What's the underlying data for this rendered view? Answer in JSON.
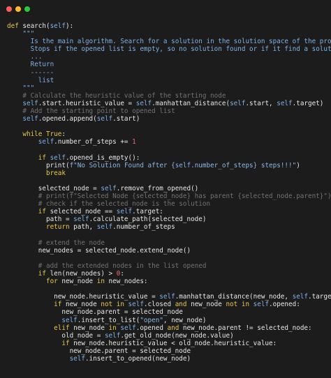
{
  "window": {
    "buttons": [
      "close",
      "minimize",
      "maximize"
    ]
  },
  "code": {
    "language": "python",
    "lines": [
      {
        "indent": 0,
        "tokens": [
          [
            "kw",
            "def "
          ],
          [
            "fn",
            "search("
          ],
          [
            "self",
            "self"
          ],
          [
            "fn",
            "):"
          ]
        ]
      },
      {
        "indent": 4,
        "tokens": [
          [
            "doc",
            "\"\"\""
          ]
        ]
      },
      {
        "indent": 6,
        "tokens": [
          [
            "doc",
            "Is the main algorithm. Search for a solution in the solution space of the problem"
          ]
        ]
      },
      {
        "indent": 6,
        "tokens": [
          [
            "doc",
            "Stops if the opened list is empty, so no solution found or if it find a solution."
          ]
        ]
      },
      {
        "indent": 6,
        "tokens": [
          [
            "doc",
            "..."
          ]
        ]
      },
      {
        "indent": 6,
        "tokens": [
          [
            "doc",
            "Return"
          ]
        ]
      },
      {
        "indent": 6,
        "tokens": [
          [
            "doc",
            "------"
          ]
        ]
      },
      {
        "indent": 8,
        "tokens": [
          [
            "doc",
            "list"
          ]
        ]
      },
      {
        "indent": 4,
        "tokens": [
          [
            "doc",
            "\"\"\""
          ]
        ]
      },
      {
        "indent": 4,
        "tokens": [
          [
            "cmt",
            "# Calculate the heuristic value of the starting node"
          ]
        ]
      },
      {
        "indent": 4,
        "tokens": [
          [
            "self",
            "self"
          ],
          [
            "fn",
            ".start.heuristic_value = "
          ],
          [
            "self",
            "self"
          ],
          [
            "fn",
            ".manhattan_distance("
          ],
          [
            "self",
            "self"
          ],
          [
            "fn",
            ".start, "
          ],
          [
            "self",
            "self"
          ],
          [
            "fn",
            ".target)"
          ]
        ]
      },
      {
        "indent": 4,
        "tokens": [
          [
            "cmt",
            "# Add the starting point to opened list"
          ]
        ]
      },
      {
        "indent": 4,
        "tokens": [
          [
            "self",
            "self"
          ],
          [
            "fn",
            ".opened.append("
          ],
          [
            "self",
            "self"
          ],
          [
            "fn",
            ".start)"
          ]
        ]
      },
      {
        "indent": 0,
        "tokens": []
      },
      {
        "indent": 4,
        "tokens": [
          [
            "kw",
            "while "
          ],
          [
            "kw",
            "True"
          ],
          [
            "fn",
            ":"
          ]
        ]
      },
      {
        "indent": 8,
        "tokens": [
          [
            "self",
            "self"
          ],
          [
            "fn",
            ".number_of_steps += "
          ],
          [
            "num",
            "1"
          ]
        ]
      },
      {
        "indent": 0,
        "tokens": []
      },
      {
        "indent": 8,
        "tokens": [
          [
            "kw",
            "if "
          ],
          [
            "self",
            "self"
          ],
          [
            "fn",
            ".opened_is_empty():"
          ]
        ]
      },
      {
        "indent": 10,
        "tokens": [
          [
            "fn",
            "print("
          ],
          [
            "str",
            "f\"No Solution Found after {"
          ],
          [
            "self",
            "self"
          ],
          [
            "str",
            ".number_of_steps} steps!!!\""
          ],
          [
            "fn",
            ")"
          ]
        ]
      },
      {
        "indent": 10,
        "tokens": [
          [
            "kw",
            "break"
          ]
        ]
      },
      {
        "indent": 0,
        "tokens": []
      },
      {
        "indent": 8,
        "tokens": [
          [
            "fn",
            "selected_node = "
          ],
          [
            "self",
            "self"
          ],
          [
            "fn",
            ".remove_from_opened()"
          ]
        ]
      },
      {
        "indent": 8,
        "tokens": [
          [
            "cmt",
            "# print(f\"Selected Node {selected_node} has parent {selected_node.parent}\")"
          ]
        ]
      },
      {
        "indent": 8,
        "tokens": [
          [
            "cmt",
            "# check if the selected_node is the solution"
          ]
        ]
      },
      {
        "indent": 8,
        "tokens": [
          [
            "kw",
            "if "
          ],
          [
            "fn",
            "selected_node == "
          ],
          [
            "self",
            "self"
          ],
          [
            "fn",
            ".target:"
          ]
        ]
      },
      {
        "indent": 10,
        "tokens": [
          [
            "fn",
            "path = "
          ],
          [
            "self",
            "self"
          ],
          [
            "fn",
            ".calculate_path(selected_node)"
          ]
        ]
      },
      {
        "indent": 10,
        "tokens": [
          [
            "kw",
            "return "
          ],
          [
            "fn",
            "path, "
          ],
          [
            "self",
            "self"
          ],
          [
            "fn",
            ".number_of_steps"
          ]
        ]
      },
      {
        "indent": 0,
        "tokens": []
      },
      {
        "indent": 8,
        "tokens": [
          [
            "cmt",
            "# extend the node"
          ]
        ]
      },
      {
        "indent": 8,
        "tokens": [
          [
            "fn",
            "new_nodes = selected_node.extend_node()"
          ]
        ]
      },
      {
        "indent": 0,
        "tokens": []
      },
      {
        "indent": 8,
        "tokens": [
          [
            "cmt",
            "# add the extended nodes in the list opened"
          ]
        ]
      },
      {
        "indent": 8,
        "tokens": [
          [
            "kw",
            "if "
          ],
          [
            "fn",
            "len(new_nodes) > "
          ],
          [
            "num",
            "0"
          ],
          [
            "fn",
            ":"
          ]
        ]
      },
      {
        "indent": 10,
        "tokens": [
          [
            "kw",
            "for "
          ],
          [
            "fn",
            "new_node "
          ],
          [
            "kw",
            "in "
          ],
          [
            "fn",
            "new_nodes:"
          ]
        ]
      },
      {
        "indent": 0,
        "tokens": []
      },
      {
        "indent": 12,
        "tokens": [
          [
            "fn",
            "new_node.heuristic_value = "
          ],
          [
            "self",
            "self"
          ],
          [
            "fn",
            ".manhattan_distance(new_node, "
          ],
          [
            "self",
            "self"
          ],
          [
            "fn",
            ".target)"
          ]
        ]
      },
      {
        "indent": 12,
        "tokens": [
          [
            "kw",
            "if "
          ],
          [
            "fn",
            "new_node "
          ],
          [
            "kw",
            "not in "
          ],
          [
            "self",
            "self"
          ],
          [
            "fn",
            ".closed "
          ],
          [
            "kw",
            "and "
          ],
          [
            "fn",
            "new_node "
          ],
          [
            "kw",
            "not in "
          ],
          [
            "self",
            "self"
          ],
          [
            "fn",
            ".opened:"
          ]
        ]
      },
      {
        "indent": 14,
        "tokens": [
          [
            "fn",
            "new_node.parent = selected_node"
          ]
        ]
      },
      {
        "indent": 14,
        "tokens": [
          [
            "self",
            "self"
          ],
          [
            "fn",
            ".insert_to_list("
          ],
          [
            "str",
            "\"open\""
          ],
          [
            "fn",
            ", new_node)"
          ]
        ]
      },
      {
        "indent": 12,
        "tokens": [
          [
            "kw",
            "elif "
          ],
          [
            "fn",
            "new_node "
          ],
          [
            "kw",
            "in "
          ],
          [
            "self",
            "self"
          ],
          [
            "fn",
            ".opened "
          ],
          [
            "kw",
            "and "
          ],
          [
            "fn",
            "new_node.parent != selected_node:"
          ]
        ]
      },
      {
        "indent": 14,
        "tokens": [
          [
            "fn",
            "old_node = "
          ],
          [
            "self",
            "self"
          ],
          [
            "fn",
            ".get_old_node(new_node.value)"
          ]
        ]
      },
      {
        "indent": 14,
        "tokens": [
          [
            "kw",
            "if "
          ],
          [
            "fn",
            "new_node.heuristic_value < old_node.heuristic_value:"
          ]
        ]
      },
      {
        "indent": 16,
        "tokens": [
          [
            "fn",
            "new_node.parent = selected_node"
          ]
        ]
      },
      {
        "indent": 16,
        "tokens": [
          [
            "self",
            "self"
          ],
          [
            "fn",
            ".insert_to_opened(new_node)"
          ]
        ]
      }
    ]
  }
}
